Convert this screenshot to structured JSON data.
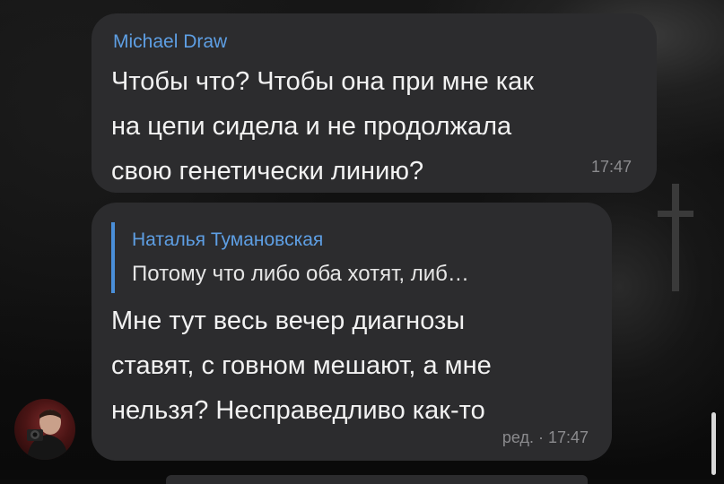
{
  "messages": [
    {
      "sender": "Michael Draw",
      "text": "Чтобы что? Чтобы она при мне как\nна цепи сидела и не продолжала\nсвою генетически линию?",
      "time": "17:47"
    },
    {
      "reply": {
        "name": "Наталья Тумановская",
        "text": "Потому что либо оба хотят, либ…"
      },
      "text": "Мне тут весь вечер диагнозы\nставят, с говном мешают, а мне\nнельзя? Несправедливо как-то",
      "time": "ред. · 17:47"
    }
  ],
  "colors": {
    "bubble": "#2c2c2e",
    "accent": "#5e9fe4",
    "timestamp": "#8b8b8e",
    "text": "#f2f2f2"
  },
  "icons": {
    "avatar": "user-avatar-photo"
  }
}
